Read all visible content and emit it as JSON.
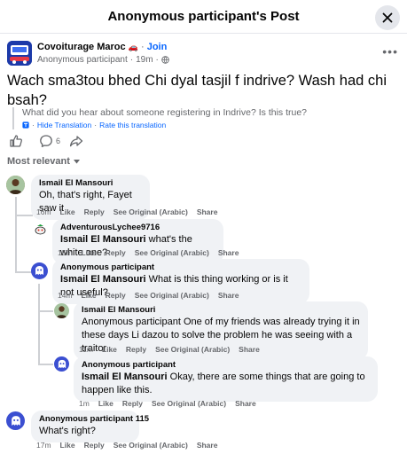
{
  "header": {
    "title": "Anonymous participant's Post"
  },
  "post": {
    "group_name": "Covoiturage Maroc",
    "group_emoji": "🚗",
    "separator": " · ",
    "join_label": "Join",
    "author": "Anonymous participant",
    "time": "19m",
    "dot": "·",
    "text": "Wach sma3tou bhed Chi dyal tasjil f indrive? Wash had chi bsah?",
    "translation": "What did you hear about someone registering in Indrive? Is this true?",
    "hide_translation": "Hide Translation",
    "rate_translation": "Rate this translation",
    "translation_sep": "·",
    "comment_count": "6"
  },
  "sort_label": "Most relevant",
  "actions_labels": {
    "like": "Like",
    "reply": "Reply",
    "see_original": "See Original (Arabic)",
    "share": "Share"
  },
  "comments": [
    {
      "author": "Ismail El Mansouri",
      "text": "Oh, that's right, Fayet saw it",
      "time": "16m"
    },
    {
      "author": "AdventurousLychee9716",
      "tag": "Ismail El Mansouri",
      "text": " what's the white one?",
      "time": "15m"
    },
    {
      "author": "Anonymous participant",
      "tag": "Ismail El Mansouri",
      "text": " What is this thing working or is it not useful?",
      "time": "14m"
    },
    {
      "author": "Ismail El Mansouri",
      "text": "Anonymous participant One of my friends was already trying it in these days Li dazou to solve the problem he was seeing with a traitor",
      "time": "11m"
    },
    {
      "author": "Anonymous participant",
      "tag": "Ismail El Mansouri",
      "text": " Okay, there are some things that are going to happen like this.",
      "time": "1m"
    },
    {
      "author": "Anonymous participant 115",
      "text": "What's right?",
      "time": "17m"
    }
  ],
  "colors": {
    "accent": "#0866ff",
    "muted": "#65676b",
    "bubble": "#f0f2f5",
    "anon_avatar": "#3b4fd1"
  }
}
